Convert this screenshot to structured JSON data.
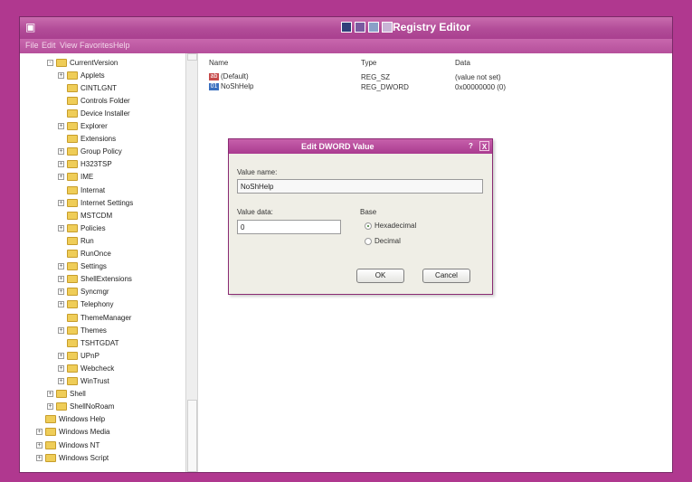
{
  "window": {
    "title": "Registry Editor"
  },
  "menu": [
    "File",
    "Edit",
    "View",
    "Favorites",
    "Help"
  ],
  "tree": {
    "items": [
      {
        "label": "CurrentVersion",
        "expander": "-"
      },
      {
        "label": "Applets",
        "expander": "+"
      },
      {
        "label": "CINTLGNT",
        "expander": ""
      },
      {
        "label": "Controls Folder",
        "expander": ""
      },
      {
        "label": "Device Installer",
        "expander": ""
      },
      {
        "label": "Explorer",
        "expander": "+"
      },
      {
        "label": "Extensions",
        "expander": ""
      },
      {
        "label": "Group Policy",
        "expander": "+"
      },
      {
        "label": "H323TSP",
        "expander": "+"
      },
      {
        "label": "IME",
        "expander": "+"
      },
      {
        "label": "Internat",
        "expander": ""
      },
      {
        "label": "Internet Settings",
        "expander": "+"
      },
      {
        "label": "MSTCDM",
        "expander": ""
      },
      {
        "label": "Policies",
        "expander": "+"
      },
      {
        "label": "Run",
        "expander": ""
      },
      {
        "label": "RunOnce",
        "expander": ""
      },
      {
        "label": "Settings",
        "expander": "+"
      },
      {
        "label": "ShellExtensions",
        "expander": "+"
      },
      {
        "label": "Syncmgr",
        "expander": "+"
      },
      {
        "label": "Telephony",
        "expander": "+"
      },
      {
        "label": "ThemeManager",
        "expander": ""
      },
      {
        "label": "Themes",
        "expander": "+"
      },
      {
        "label": "TSHTGDAT",
        "expander": ""
      },
      {
        "label": "UPnP",
        "expander": "+"
      },
      {
        "label": "Webcheck",
        "expander": "+"
      },
      {
        "label": "WinTrust",
        "expander": "+"
      },
      {
        "label": "Shell",
        "expander": "+"
      },
      {
        "label": "ShellNoRoam",
        "expander": "+"
      },
      {
        "label": "Windows Help",
        "expander": ""
      },
      {
        "label": "Windows Media",
        "expander": "+"
      },
      {
        "label": "Windows NT",
        "expander": "+"
      },
      {
        "label": "Windows Script",
        "expander": "+"
      }
    ]
  },
  "list": {
    "headers": {
      "name": "Name",
      "type": "Type",
      "data": "Data"
    },
    "rows": [
      {
        "icon": "string-value-icon",
        "name": "(Default)",
        "type": "REG_SZ",
        "data": "(value not set)"
      },
      {
        "icon": "dword-value-icon",
        "name": "NoShHelp",
        "type": "REG_DWORD",
        "data": "0x00000000 (0)"
      }
    ]
  },
  "dialog": {
    "title": "Edit DWORD Value",
    "help": "?",
    "close": "X",
    "value_name_label": "Value name:",
    "value_name": "NoShHelp",
    "value_data_label": "Value data:",
    "value_data": "0",
    "base_label": "Base",
    "base_options": [
      "Hexadecimal",
      "Decimal"
    ],
    "base_selected": "Hexadecimal",
    "ok_label": "OK",
    "cancel_label": "Cancel"
  },
  "colors": {
    "accent": "#b0388f",
    "titlebar": "#b24c98",
    "folder": "#efcd58"
  }
}
